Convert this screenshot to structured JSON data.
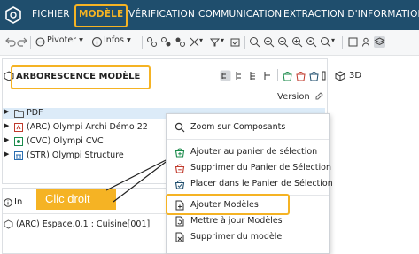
{
  "colors": {
    "topbar": "#1f4e6d",
    "accent": "#f5b324",
    "selection": "#dcebf8"
  },
  "menu": {
    "items": [
      "FICHIER",
      "MODÈLE",
      "VÉRIFICATION",
      "COMMUNICATION",
      "EXTRACTION D'INFORMATIONS"
    ],
    "active_index": 1
  },
  "toolbar": {
    "pivoter_label": "Pivoter",
    "infos_label": "Infos"
  },
  "tree_panel": {
    "title": "ARBORESCENCE MODÈLE",
    "version_label": "Version",
    "items": [
      {
        "label": "PDF",
        "icon": "folder-icon"
      },
      {
        "label": "(ARC) Olympi Archi Démo 22",
        "icon": "architecture-model-icon"
      },
      {
        "label": "(CVC) Olympi CVC",
        "icon": "hvac-model-icon"
      },
      {
        "label": "(STR) Olympi Structure",
        "icon": "structure-model-icon"
      }
    ]
  },
  "view": {
    "label": "3D"
  },
  "info_panel": {
    "title_prefix": "In",
    "element_label": "(ARC) Espace.0.1 : Cuisine[001]"
  },
  "context_menu": {
    "items": [
      {
        "label": "Zoom sur Composants",
        "icon": "search-icon"
      },
      {
        "label": "Ajouter au panier de sélection",
        "icon": "basket-add-icon"
      },
      {
        "label": "Supprimer du Panier de Sélection",
        "icon": "basket-remove-icon"
      },
      {
        "label": "Placer dans le Panier de Sélection",
        "icon": "basket-place-icon"
      },
      {
        "label": "Ajouter Modèles",
        "icon": "add-document-icon",
        "highlighted": true
      },
      {
        "label": "Mettre à jour Modèles",
        "icon": "update-document-icon"
      },
      {
        "label": "Supprimer du modèle",
        "icon": "remove-document-icon"
      }
    ]
  },
  "annotation": {
    "callout_text": "Clic droit"
  }
}
